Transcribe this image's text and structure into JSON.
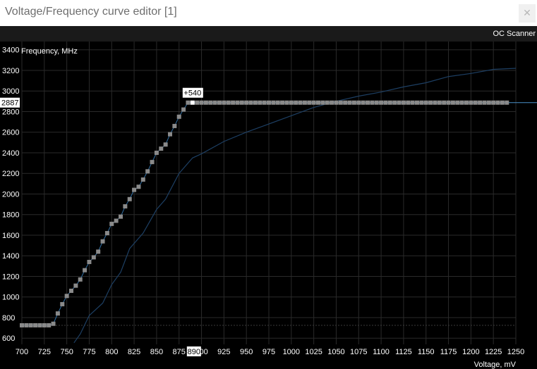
{
  "window": {
    "title": "Voltage/Frequency curve editor [1]",
    "close_glyph": "✕"
  },
  "toolbar": {
    "oc_scanner_label": "OC Scanner"
  },
  "colors": {
    "background": "#000000",
    "grid": "#2a2a2a",
    "curve": "#2f6ea3",
    "reference_curve": "#1d3f63",
    "point": "#8a8a8a",
    "selected_point": "#ffffff",
    "label_box": "#ffffff",
    "label_text": "#000000",
    "reference_line": "#4a90c8"
  },
  "chart_data": {
    "type": "line",
    "title": "",
    "ylabel": "Frequency, MHz",
    "xlabel": "Voltage, mV",
    "xlim": [
      700,
      1250
    ],
    "ylim": [
      540,
      3480
    ],
    "x_ticks": [
      700,
      725,
      750,
      775,
      800,
      825,
      850,
      875,
      900,
      925,
      950,
      975,
      1000,
      1025,
      1050,
      1075,
      1100,
      1125,
      1150,
      1175,
      1200,
      1225,
      1250
    ],
    "y_ticks": [
      600,
      800,
      1000,
      1200,
      1400,
      1600,
      1800,
      2000,
      2200,
      2400,
      2600,
      2800,
      3000,
      3200,
      3400
    ],
    "grid": true,
    "selected_voltage": 890,
    "selected_voltage_label": "890",
    "frequency_readout": 2887,
    "frequency_readout_label": "2887",
    "offset_label": "+540",
    "series": [
      {
        "role": "curve",
        "x": [
          700,
          705,
          710,
          715,
          720,
          725,
          730,
          735,
          740,
          745,
          750,
          755,
          760,
          765,
          770,
          775,
          780,
          785,
          790,
          795,
          800,
          805,
          810,
          815,
          820,
          825,
          830,
          835,
          840,
          845,
          850,
          855,
          860,
          865,
          870,
          875,
          880,
          885,
          890,
          895,
          900,
          905,
          910,
          915,
          920,
          925,
          930,
          935,
          940,
          945,
          950,
          955,
          960,
          965,
          970,
          975,
          980,
          985,
          990,
          995,
          1000,
          1005,
          1010,
          1015,
          1020,
          1025,
          1030,
          1035,
          1040,
          1045,
          1050,
          1055,
          1060,
          1065,
          1070,
          1075,
          1080,
          1085,
          1090,
          1095,
          1100,
          1105,
          1110,
          1115,
          1120,
          1125,
          1130,
          1135,
          1140,
          1145,
          1150,
          1155,
          1160,
          1165,
          1170,
          1175,
          1180,
          1185,
          1190,
          1195,
          1200,
          1205,
          1210,
          1215,
          1220,
          1225,
          1230,
          1235,
          1240
        ],
        "y": [
          725,
          725,
          725,
          725,
          725,
          725,
          725,
          740,
          840,
          930,
          1010,
          1060,
          1110,
          1170,
          1260,
          1340,
          1385,
          1440,
          1540,
          1620,
          1710,
          1740,
          1780,
          1880,
          1950,
          2040,
          2070,
          2140,
          2220,
          2310,
          2400,
          2440,
          2480,
          2580,
          2660,
          2750,
          2820,
          2887,
          2887,
          2887,
          2887,
          2887,
          2887,
          2887,
          2887,
          2887,
          2887,
          2887,
          2887,
          2887,
          2887,
          2887,
          2887,
          2887,
          2887,
          2887,
          2887,
          2887,
          2887,
          2887,
          2887,
          2887,
          2887,
          2887,
          2887,
          2887,
          2887,
          2887,
          2887,
          2887,
          2887,
          2887,
          2887,
          2887,
          2887,
          2887,
          2887,
          2887,
          2887,
          2887,
          2887,
          2887,
          2887,
          2887,
          2887,
          2887,
          2887,
          2887,
          2887,
          2887,
          2887,
          2887,
          2887,
          2887,
          2887,
          2887,
          2887,
          2887,
          2887,
          2887,
          2887,
          2887,
          2887,
          2887,
          2887,
          2887,
          2887,
          2887,
          2887
        ]
      },
      {
        "role": "default_curve",
        "x": [
          758,
          765,
          775,
          790,
          800,
          810,
          820,
          835,
          850,
          860,
          875,
          890,
          900,
          925,
          950,
          975,
          1000,
          1025,
          1050,
          1075,
          1100,
          1125,
          1150,
          1175,
          1200,
          1225,
          1250
        ],
        "y": [
          555,
          640,
          820,
          940,
          1120,
          1240,
          1470,
          1620,
          1850,
          1950,
          2200,
          2350,
          2390,
          2510,
          2600,
          2680,
          2760,
          2840,
          2900,
          2950,
          2990,
          3040,
          3080,
          3140,
          3170,
          3210,
          3220
        ]
      }
    ]
  }
}
